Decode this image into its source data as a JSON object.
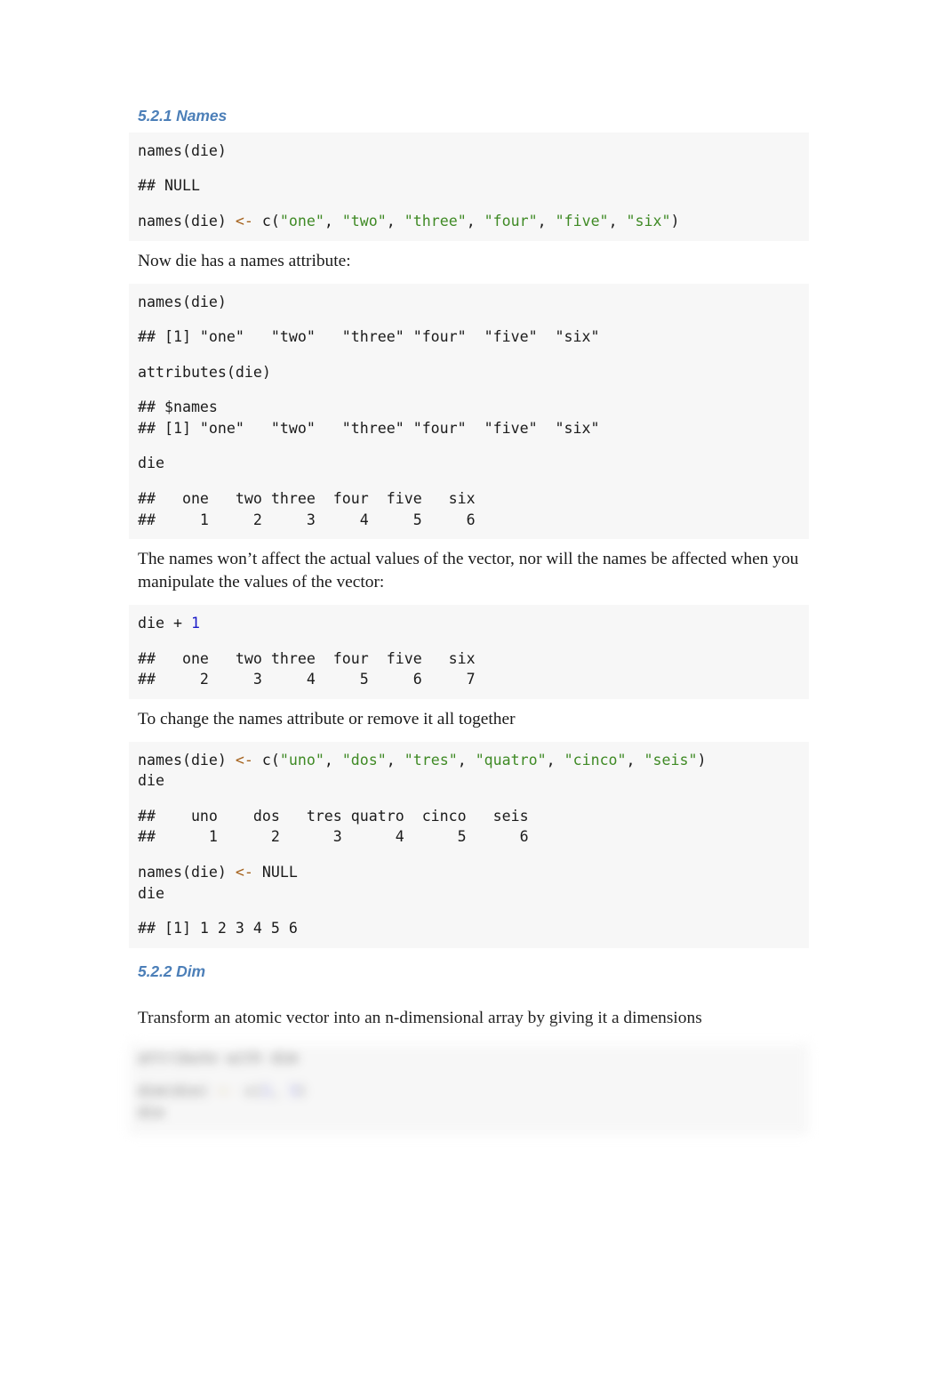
{
  "document": {
    "type": "r-markdown-rendered-book-page",
    "background_color": "#ffffff",
    "code_background_color": "#f7f7f7",
    "heading_color": "#4c7fb8",
    "string_token_color": "#3f8a25",
    "operator_token_color": "#a4601a",
    "number_token_color": "#1a1ac8"
  },
  "sections": {
    "names": {
      "heading": "5.2.1 Names",
      "block1": {
        "line1": "names(die)",
        "line2": "## NULL",
        "line3_pre": "names(die) ",
        "line3_op": "<-",
        "line3_mid": " c(",
        "line3_s1": "\"one\"",
        "line3_c1": ", ",
        "line3_s2": "\"two\"",
        "line3_c2": ", ",
        "line3_s3": "\"three\"",
        "line3_c3": ", ",
        "line3_s4": "\"four\"",
        "line3_c4": ", ",
        "line3_s5": "\"five\"",
        "line3_c5": ", ",
        "line3_s6": "\"six\"",
        "line3_end": ")"
      },
      "prose1": "Now die has a names attribute:",
      "block2": {
        "line1": "names(die)",
        "line2": "## [1] \"one\"   \"two\"   \"three\" \"four\"  \"five\"  \"six\"",
        "line3": "attributes(die)",
        "line4": "## $names",
        "line5": "## [1] \"one\"   \"two\"   \"three\" \"four\"  \"five\"  \"six\"",
        "line6": "die",
        "line7": "##   one   two three  four  five   six",
        "line8": "##     1     2     3     4     5     6"
      },
      "prose2": "The names won’t affect the actual values of the vector, nor will the names be affected when you manipulate the values of the vector:",
      "block3": {
        "line1_pre": "die + ",
        "line1_num": "1",
        "line2": "##   one   two three  four  five   six",
        "line3": "##     2     3     4     5     6     7"
      },
      "prose3": "To change the names attribute or remove it all together",
      "block4": {
        "line1_pre": "names(die) ",
        "line1_op": "<-",
        "line1_mid": " c(",
        "line1_s1": "\"uno\"",
        "line1_c1": ", ",
        "line1_s2": "\"dos\"",
        "line1_c2": ", ",
        "line1_s3": "\"tres\"",
        "line1_c3": ", ",
        "line1_s4": "\"quatro\"",
        "line1_c4": ", ",
        "line1_s5": "\"cinco\"",
        "line1_c5": ", ",
        "line1_s6": "\"seis\"",
        "line1_end": ")",
        "line2": "die",
        "line3": "##    uno    dos   tres quatro  cinco   seis",
        "line4": "##      1      2      3      4      5      6"
      },
      "block5": {
        "line1_pre": "names(die) ",
        "line1_op": "<-",
        "line1_post": " NULL",
        "line2": "die",
        "line3": "## [1] 1 2 3 4 5 6"
      }
    },
    "dim": {
      "heading": "5.2.2 Dim",
      "prose1": "Transform an atomic vector into an n-dimensional array by giving it a dimensions",
      "unrendered": {
        "note": "blurred unrendered region",
        "line1": "attribute with dim",
        "line2_pre": "dim(die) ",
        "line2_op": "<-",
        "line2_mid": " c(",
        "line2_n1": "2",
        "line2_c1": ", ",
        "line2_n2": "3",
        "line2_end": ")",
        "line3": "die"
      }
    }
  }
}
